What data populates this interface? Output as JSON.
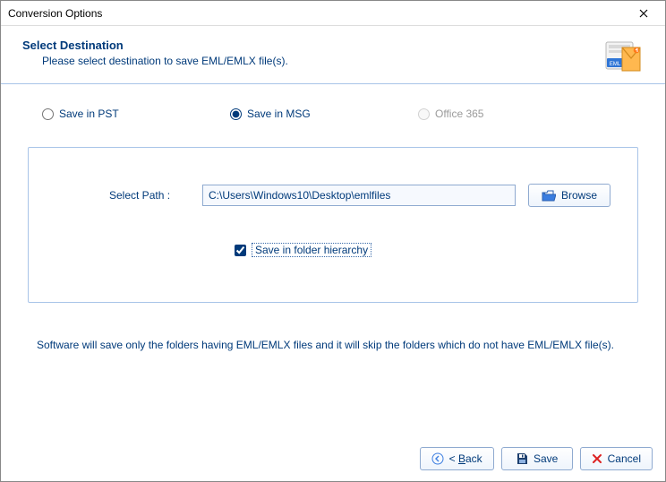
{
  "window": {
    "title": "Conversion Options"
  },
  "header": {
    "title": "Select Destination",
    "subtitle": "Please select destination to save EML/EMLX file(s)."
  },
  "options": {
    "pst": "Save in PST",
    "msg": "Save in MSG",
    "o365": "Office 365",
    "selected": "msg"
  },
  "path": {
    "label": "Select Path :",
    "value": "C:\\Users\\Windows10\\Desktop\\emlfiles",
    "browse": "Browse"
  },
  "checkbox": {
    "label": "Save in folder hierarchy",
    "checked": true
  },
  "note": "Software will save only the folders having EML/EMLX files and it will skip the folders which do not have EML/EMLX file(s).",
  "buttons": {
    "back_prefix": "< ",
    "back_u": "B",
    "back_rest": "ack",
    "save": "Save",
    "cancel": "Cancel"
  }
}
